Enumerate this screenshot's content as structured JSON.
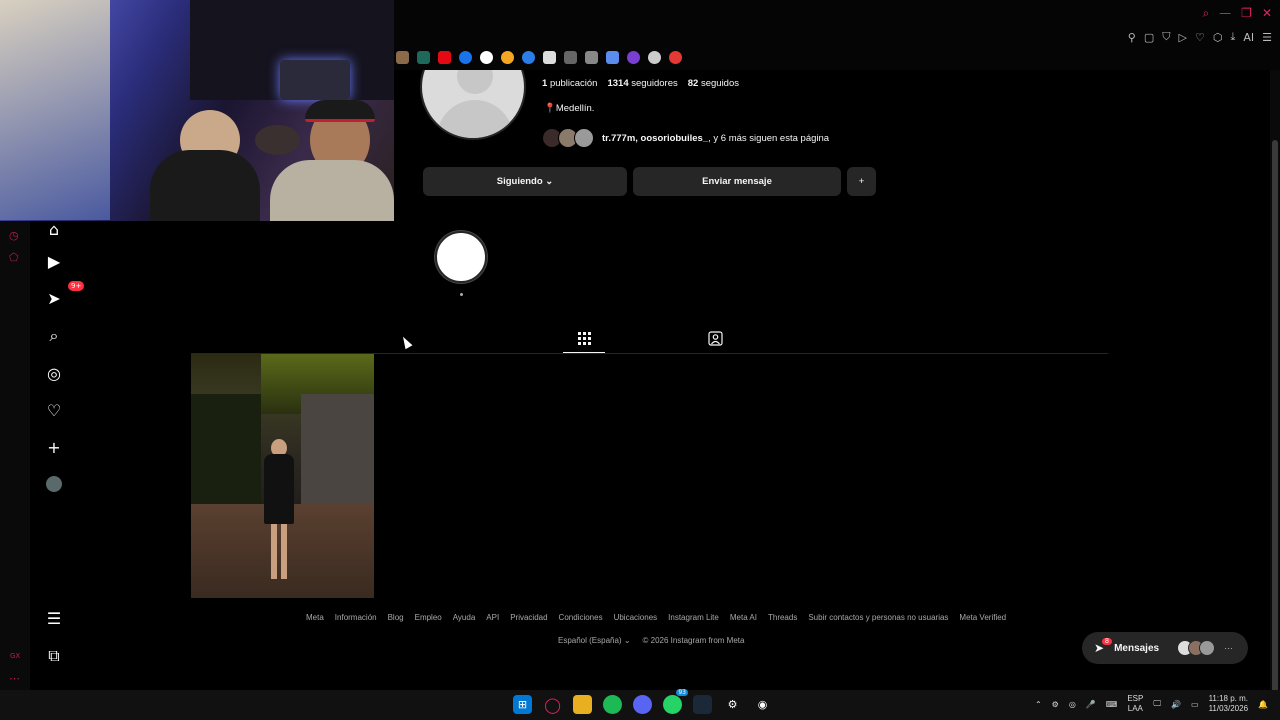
{
  "profile": {
    "posts_count": "1",
    "posts_label": "publicación",
    "followers_count": "1314",
    "followers_label": "seguidores",
    "following_count": "82",
    "following_label": "seguidos",
    "location_pin": "📍",
    "location": "Medellín.",
    "followed_by_names": "tr.777m, oosoriobuiles_",
    "followed_by_rest": ", y 6 más siguen esta página"
  },
  "actions": {
    "following_btn": "Siguiendo",
    "following_chevron": "⌄",
    "message_btn": "Enviar mensaje",
    "add_user_icon": "+"
  },
  "nav": {
    "notifications_badge": "9+"
  },
  "footer": {
    "links": [
      "Meta",
      "Información",
      "Blog",
      "Empleo",
      "Ayuda",
      "API",
      "Privacidad",
      "Condiciones",
      "Ubicaciones",
      "Instagram Lite",
      "Meta AI",
      "Threads",
      "Subir contactos y personas no usuarias",
      "Meta Verified"
    ],
    "language": "Español (España)",
    "language_chevron": "⌄",
    "copyright": "© 2026 Instagram from Meta"
  },
  "messages": {
    "label": "Mensajes",
    "badge": "8",
    "more": "···"
  },
  "taskbar": {
    "lang_top": "ESP",
    "lang_bottom": "LAA",
    "time": "11:18 p. m.",
    "date": "11/03/2026",
    "whatsapp_badge": "93"
  },
  "colors": {
    "background": "#000000",
    "accent": "#ff3040",
    "opera_red": "#e0245e",
    "button_bg": "#262626"
  }
}
